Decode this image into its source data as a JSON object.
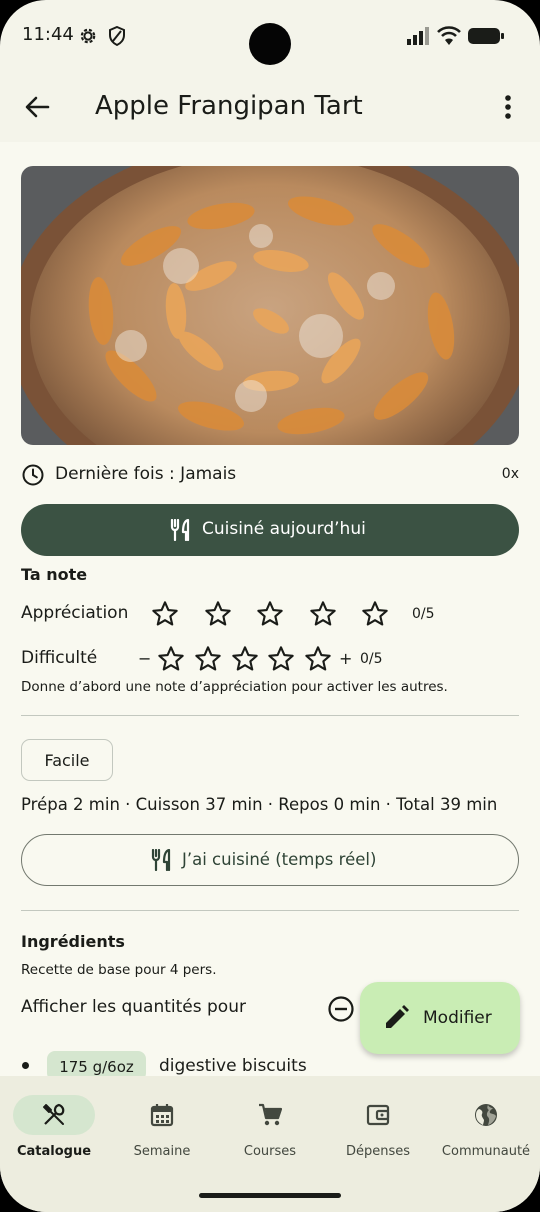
{
  "status_bar": {
    "time": "11:44"
  },
  "app_bar": {
    "title": "Apple Frangipan Tart"
  },
  "recipe": {
    "last_cooked_label": "Dernière fois : Jamais",
    "cooked_count": "0x",
    "cooked_today_button": "Cuisiné aujourd’hui"
  },
  "rating": {
    "section_title": "Ta note",
    "appreciation_label": "Appréciation",
    "appreciation_value": 0,
    "appreciation_score": "0/5",
    "difficulty_label": "Difficulté",
    "difficulty_value": 0,
    "difficulty_minus": "−",
    "difficulty_plus": "+",
    "difficulty_score": "0/5",
    "hint": "Donne d’abord une note d’appréciation pour activer les autres."
  },
  "difficulty_chip": "Facile",
  "times_line": "Prépa 2 min · Cuisson 37 min · Repos 0 min · Total 39 min",
  "realtime_button": "J’ai cuisiné (temps réel)",
  "ingredients": {
    "title": "Ingrédients",
    "base_recipe": "Recette de base pour 4 pers.",
    "portion_label": "Afficher les quantités pour",
    "items": [
      {
        "quantity": "175 g/6oz",
        "name": "digestive biscuits"
      }
    ]
  },
  "fab": {
    "label": "Modifier",
    "icon": "pencil-icon"
  },
  "bottom_nav": {
    "active": "Catalogue",
    "items": [
      {
        "label": "Catalogue",
        "icon": "utensils-icon"
      },
      {
        "label": "Semaine",
        "icon": "calendar-icon"
      },
      {
        "label": "Courses",
        "icon": "cart-icon"
      },
      {
        "label": "Dépenses",
        "icon": "wallet-icon"
      },
      {
        "label": "Communauté",
        "icon": "globe-icon"
      }
    ]
  },
  "colors": {
    "primary": "#3b5243",
    "fab": "#c9edb4",
    "chip": "#d5e6cf",
    "background": "#f9f9f0"
  }
}
